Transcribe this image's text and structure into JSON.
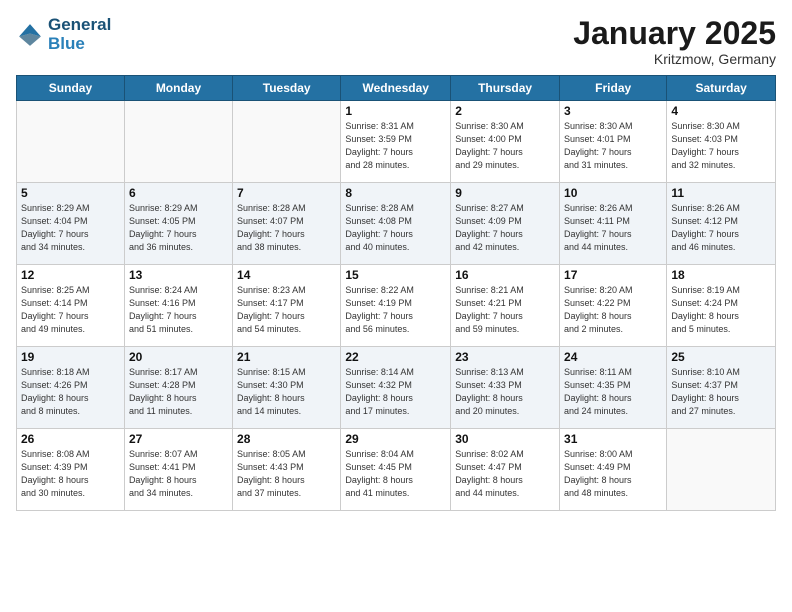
{
  "logo": {
    "line1": "General",
    "line2": "Blue"
  },
  "title": "January 2025",
  "location": "Kritzmow, Germany",
  "weekdays": [
    "Sunday",
    "Monday",
    "Tuesday",
    "Wednesday",
    "Thursday",
    "Friday",
    "Saturday"
  ],
  "weeks": [
    [
      {
        "day": "",
        "info": ""
      },
      {
        "day": "",
        "info": ""
      },
      {
        "day": "",
        "info": ""
      },
      {
        "day": "1",
        "info": "Sunrise: 8:31 AM\nSunset: 3:59 PM\nDaylight: 7 hours\nand 28 minutes."
      },
      {
        "day": "2",
        "info": "Sunrise: 8:30 AM\nSunset: 4:00 PM\nDaylight: 7 hours\nand 29 minutes."
      },
      {
        "day": "3",
        "info": "Sunrise: 8:30 AM\nSunset: 4:01 PM\nDaylight: 7 hours\nand 31 minutes."
      },
      {
        "day": "4",
        "info": "Sunrise: 8:30 AM\nSunset: 4:03 PM\nDaylight: 7 hours\nand 32 minutes."
      }
    ],
    [
      {
        "day": "5",
        "info": "Sunrise: 8:29 AM\nSunset: 4:04 PM\nDaylight: 7 hours\nand 34 minutes."
      },
      {
        "day": "6",
        "info": "Sunrise: 8:29 AM\nSunset: 4:05 PM\nDaylight: 7 hours\nand 36 minutes."
      },
      {
        "day": "7",
        "info": "Sunrise: 8:28 AM\nSunset: 4:07 PM\nDaylight: 7 hours\nand 38 minutes."
      },
      {
        "day": "8",
        "info": "Sunrise: 8:28 AM\nSunset: 4:08 PM\nDaylight: 7 hours\nand 40 minutes."
      },
      {
        "day": "9",
        "info": "Sunrise: 8:27 AM\nSunset: 4:09 PM\nDaylight: 7 hours\nand 42 minutes."
      },
      {
        "day": "10",
        "info": "Sunrise: 8:26 AM\nSunset: 4:11 PM\nDaylight: 7 hours\nand 44 minutes."
      },
      {
        "day": "11",
        "info": "Sunrise: 8:26 AM\nSunset: 4:12 PM\nDaylight: 7 hours\nand 46 minutes."
      }
    ],
    [
      {
        "day": "12",
        "info": "Sunrise: 8:25 AM\nSunset: 4:14 PM\nDaylight: 7 hours\nand 49 minutes."
      },
      {
        "day": "13",
        "info": "Sunrise: 8:24 AM\nSunset: 4:16 PM\nDaylight: 7 hours\nand 51 minutes."
      },
      {
        "day": "14",
        "info": "Sunrise: 8:23 AM\nSunset: 4:17 PM\nDaylight: 7 hours\nand 54 minutes."
      },
      {
        "day": "15",
        "info": "Sunrise: 8:22 AM\nSunset: 4:19 PM\nDaylight: 7 hours\nand 56 minutes."
      },
      {
        "day": "16",
        "info": "Sunrise: 8:21 AM\nSunset: 4:21 PM\nDaylight: 7 hours\nand 59 minutes."
      },
      {
        "day": "17",
        "info": "Sunrise: 8:20 AM\nSunset: 4:22 PM\nDaylight: 8 hours\nand 2 minutes."
      },
      {
        "day": "18",
        "info": "Sunrise: 8:19 AM\nSunset: 4:24 PM\nDaylight: 8 hours\nand 5 minutes."
      }
    ],
    [
      {
        "day": "19",
        "info": "Sunrise: 8:18 AM\nSunset: 4:26 PM\nDaylight: 8 hours\nand 8 minutes."
      },
      {
        "day": "20",
        "info": "Sunrise: 8:17 AM\nSunset: 4:28 PM\nDaylight: 8 hours\nand 11 minutes."
      },
      {
        "day": "21",
        "info": "Sunrise: 8:15 AM\nSunset: 4:30 PM\nDaylight: 8 hours\nand 14 minutes."
      },
      {
        "day": "22",
        "info": "Sunrise: 8:14 AM\nSunset: 4:32 PM\nDaylight: 8 hours\nand 17 minutes."
      },
      {
        "day": "23",
        "info": "Sunrise: 8:13 AM\nSunset: 4:33 PM\nDaylight: 8 hours\nand 20 minutes."
      },
      {
        "day": "24",
        "info": "Sunrise: 8:11 AM\nSunset: 4:35 PM\nDaylight: 8 hours\nand 24 minutes."
      },
      {
        "day": "25",
        "info": "Sunrise: 8:10 AM\nSunset: 4:37 PM\nDaylight: 8 hours\nand 27 minutes."
      }
    ],
    [
      {
        "day": "26",
        "info": "Sunrise: 8:08 AM\nSunset: 4:39 PM\nDaylight: 8 hours\nand 30 minutes."
      },
      {
        "day": "27",
        "info": "Sunrise: 8:07 AM\nSunset: 4:41 PM\nDaylight: 8 hours\nand 34 minutes."
      },
      {
        "day": "28",
        "info": "Sunrise: 8:05 AM\nSunset: 4:43 PM\nDaylight: 8 hours\nand 37 minutes."
      },
      {
        "day": "29",
        "info": "Sunrise: 8:04 AM\nSunset: 4:45 PM\nDaylight: 8 hours\nand 41 minutes."
      },
      {
        "day": "30",
        "info": "Sunrise: 8:02 AM\nSunset: 4:47 PM\nDaylight: 8 hours\nand 44 minutes."
      },
      {
        "day": "31",
        "info": "Sunrise: 8:00 AM\nSunset: 4:49 PM\nDaylight: 8 hours\nand 48 minutes."
      },
      {
        "day": "",
        "info": ""
      }
    ]
  ]
}
